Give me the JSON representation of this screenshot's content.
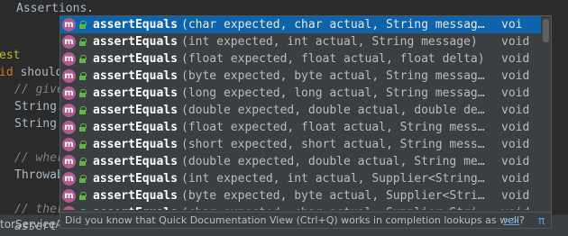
{
  "editor": {
    "line_assertions": "Assertions.",
    "line_test_annotation": "est",
    "line_method_kw": "id",
    "line_method_name": "should",
    "line_given_comment": "// give",
    "line_string1": "String",
    "line_string2": "String",
    "line_when_comment": "// wher",
    "line_throwable": "Throwab",
    "line_then_comment": "// ther",
    "line_assert": "assert",
    "status_text": "torServiceA"
  },
  "popup": {
    "items": [
      {
        "name": "assertEquals",
        "params": "(char expected, char actual, String message)",
        "rtype": "voi",
        "selected": true
      },
      {
        "name": "assertEquals",
        "params": "(int expected, int actual, String message)",
        "rtype": "void"
      },
      {
        "name": "assertEquals",
        "params": "(float expected, float actual, float delta)",
        "rtype": "void"
      },
      {
        "name": "assertEquals",
        "params": "(byte expected, byte actual, String messag…",
        "rtype": "void"
      },
      {
        "name": "assertEquals",
        "params": "(long expected, long actual, String messag…",
        "rtype": "void"
      },
      {
        "name": "assertEquals",
        "params": "(double expected, double actual, double de…",
        "rtype": "void"
      },
      {
        "name": "assertEquals",
        "params": "(float expected, float actual, String mess…",
        "rtype": "void"
      },
      {
        "name": "assertEquals",
        "params": "(short expected, short actual, String mess…",
        "rtype": "void"
      },
      {
        "name": "assertEquals",
        "params": "(double expected, double actual, String me…",
        "rtype": "void"
      },
      {
        "name": "assertEquals",
        "params": "(int expected, int actual, Supplier<String…",
        "rtype": "void"
      },
      {
        "name": "assertEquals",
        "params": "(byte expected, byte actual, Supplier<Stri…",
        "rtype": "void"
      },
      {
        "name": "assertEquals",
        "params": "(char expected, char actual, Supplier<Stri…",
        "rtype": "void"
      }
    ],
    "item_icon_letter": "m",
    "hint_text": "Did you know that Quick Documentation View (Ctrl+Q) works in completion lookups as well?",
    "hint_link": ">>",
    "pi_symbol": "π"
  },
  "colors": {
    "background": "#2b2b2b",
    "popup_bg": "#3c3f41",
    "selection": "#0d64ab",
    "method_icon": "#b25b8c",
    "annotation": "#bbb529",
    "keyword": "#cc7832",
    "comment": "#808080",
    "link": "#589df6"
  }
}
